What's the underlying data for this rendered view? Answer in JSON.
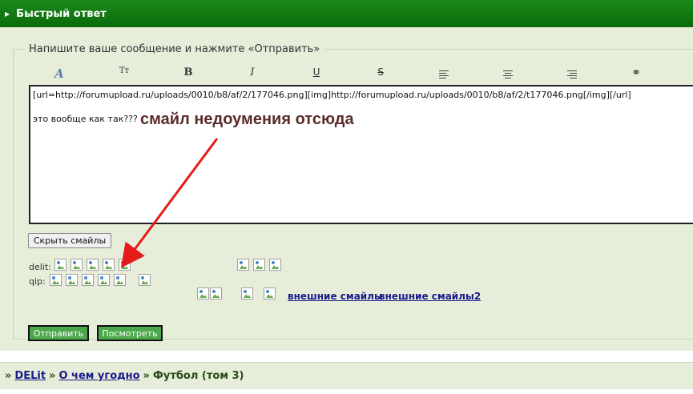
{
  "header": {
    "title": "Быстрый ответ"
  },
  "form": {
    "legend": "Напишите ваше сообщение и нажмите «Отправить»",
    "toolbar": [
      {
        "name": "font-color-icon",
        "glyph": "A"
      },
      {
        "name": "font-size-icon",
        "glyph": "Tт"
      },
      {
        "name": "bold-icon",
        "glyph": "B"
      },
      {
        "name": "italic-icon",
        "glyph": "I"
      },
      {
        "name": "underline-icon",
        "glyph": "U"
      },
      {
        "name": "strikethrough-icon",
        "glyph": "S"
      },
      {
        "name": "align-left-icon",
        "glyph": ""
      },
      {
        "name": "align-center-icon",
        "glyph": ""
      },
      {
        "name": "align-right-icon",
        "glyph": ""
      },
      {
        "name": "link-icon",
        "glyph": "⚭"
      }
    ],
    "message": "[url=http://forumupload.ru/uploads/0010/b8/af/2/177046.png][img]http://forumupload.ru/uploads/0010/b8/af/2/t177046.png[/img][/url]\n\nэто вообще как так???",
    "hide_smiles": "Скрыть смайлы",
    "smile_groups": [
      {
        "label": "delit:"
      },
      {
        "label": "qip:"
      }
    ],
    "external_links": [
      "внешние смайлы",
      "внешние смайлы2"
    ],
    "submit": "Отправить",
    "preview": "Посмотреть"
  },
  "annotation": {
    "text": "смайл недоумения отсюда",
    "color": "#e31b1b"
  },
  "breadcrumb": {
    "prefix": "»",
    "items": [
      "DELit",
      "О чем угодно"
    ],
    "current": "Футбол (том 3)"
  },
  "colors": {
    "header": "#0b6a0b",
    "panel": "#e6edd9",
    "button": "#4aa84a",
    "link": "#1a1a8a"
  }
}
